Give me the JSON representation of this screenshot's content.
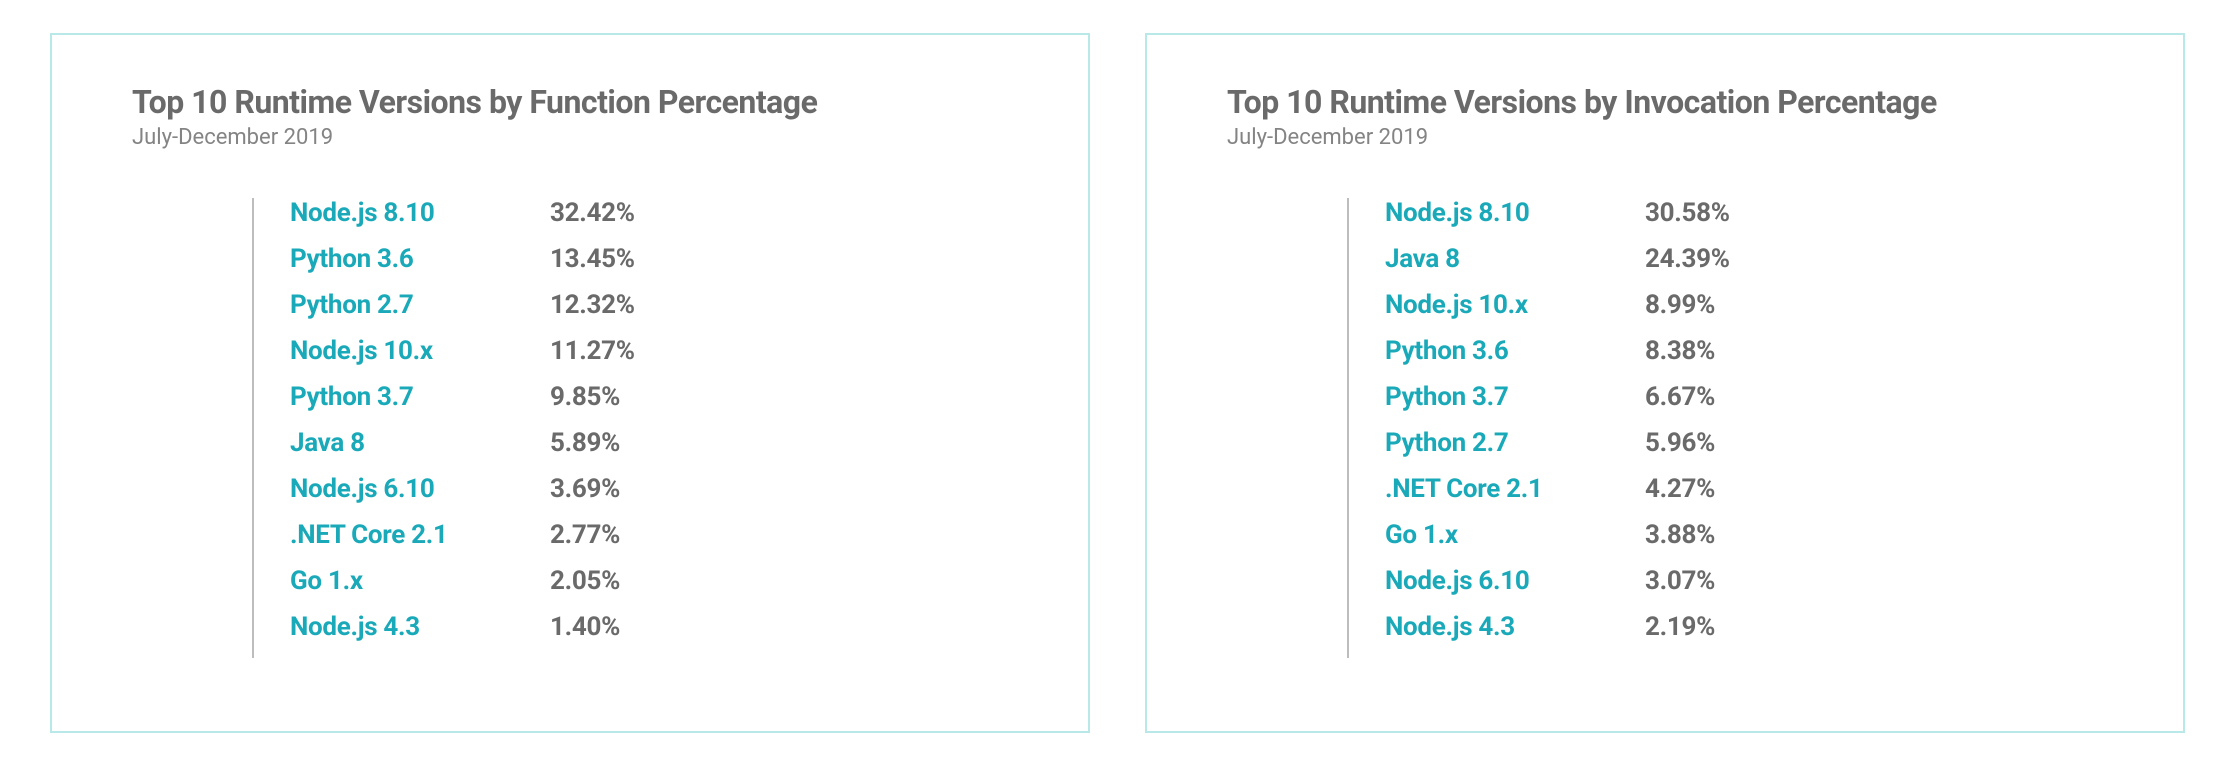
{
  "chart_data": [
    {
      "type": "table",
      "title": "Top 10 Runtime Versions by Function Percentage",
      "subtitle": "July-December 2019",
      "categories": [
        "Node.js 8.10",
        "Python 3.6",
        "Python 2.7",
        "Node.js 10.x",
        "Python 3.7",
        "Java 8",
        "Node.js 6.10",
        ".NET Core 2.1",
        "Go 1.x",
        "Node.js 4.3"
      ],
      "values": [
        32.42,
        13.45,
        12.32,
        11.27,
        9.85,
        5.89,
        3.69,
        2.77,
        2.05,
        1.4
      ],
      "value_labels": [
        "32.42%",
        "13.45%",
        "12.32%",
        "11.27%",
        "9.85%",
        "5.89%",
        "3.69%",
        "2.77%",
        "2.05%",
        "1.40%"
      ]
    },
    {
      "type": "table",
      "title": "Top 10 Runtime Versions by Invocation Percentage",
      "subtitle": "July-December 2019",
      "categories": [
        "Node.js 8.10",
        "Java 8",
        "Node.js 10.x",
        "Python 3.6",
        "Python 3.7",
        "Python 2.7",
        ".NET Core 2.1",
        "Go 1.x",
        "Node.js 6.10",
        "Node.js 4.3"
      ],
      "values": [
        30.58,
        24.39,
        8.99,
        8.38,
        6.67,
        5.96,
        4.27,
        3.88,
        3.07,
        2.19
      ],
      "value_labels": [
        "30.58%",
        "24.39%",
        "8.99%",
        "8.38%",
        "6.67%",
        "5.96%",
        "4.27%",
        "3.88%",
        "3.07%",
        "2.19%"
      ]
    }
  ]
}
